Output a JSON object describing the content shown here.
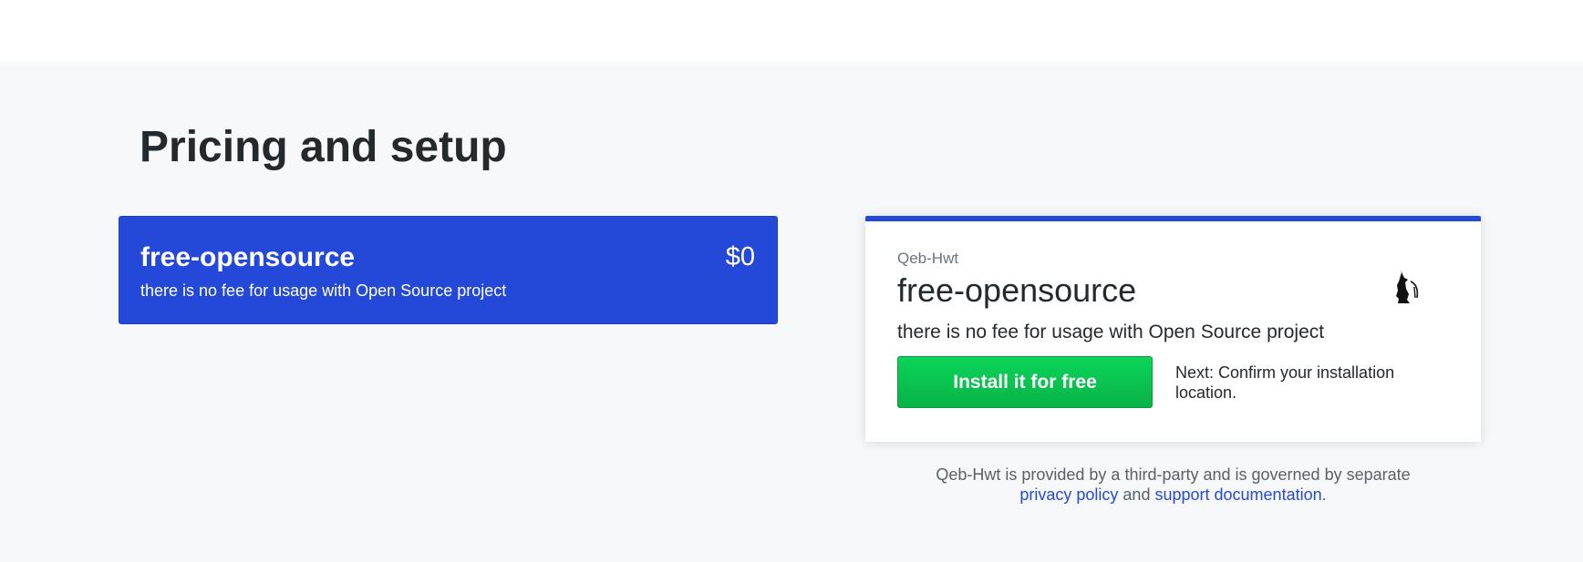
{
  "page": {
    "title": "Pricing and setup"
  },
  "plan": {
    "name": "free-opensource",
    "price": "$0",
    "description": "there is no fee for usage with Open Source project"
  },
  "install_card": {
    "vendor": "Qeb-Hwt",
    "plan_name": "free-opensource",
    "description": "there is no fee for usage with Open Source project",
    "install_button_label": "Install it for free",
    "next_step_text": "Next: Confirm your installation location."
  },
  "footer": {
    "text_before": "Qeb-Hwt is provided by a third-party and is governed by separate",
    "privacy_link": "privacy policy",
    "and_text": "and",
    "support_link": "support documentation",
    "period": "."
  },
  "colors": {
    "accent_blue": "#2449d8",
    "install_green": "#08b347",
    "background": "#f6f8fa"
  },
  "icons": {
    "logo": "qeb-hwt-logo-icon"
  }
}
